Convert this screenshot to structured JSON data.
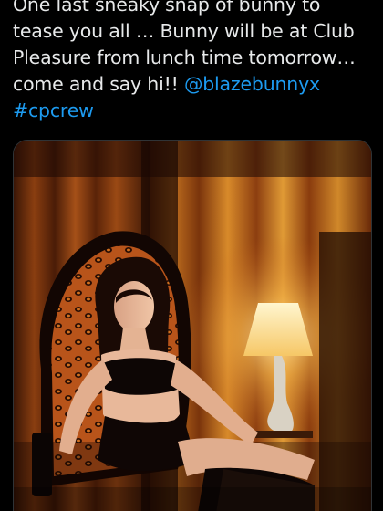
{
  "tweet": {
    "text_parts": [
      {
        "kind": "text",
        "value": "One last sneaky snap of bunny to tease you all … Bunny will be at Club Pleasure from lunch time tomorrow… come and say hi!! "
      },
      {
        "kind": "mention",
        "value": "@blazebunnyx"
      },
      {
        "kind": "text",
        "value": " "
      },
      {
        "kind": "hashtag",
        "value": "#cpcrew"
      }
    ],
    "media": {
      "kind": "photo"
    }
  },
  "colors": {
    "background": "#000000",
    "text": "#e7e9ea",
    "link": "#1d9bf0"
  }
}
